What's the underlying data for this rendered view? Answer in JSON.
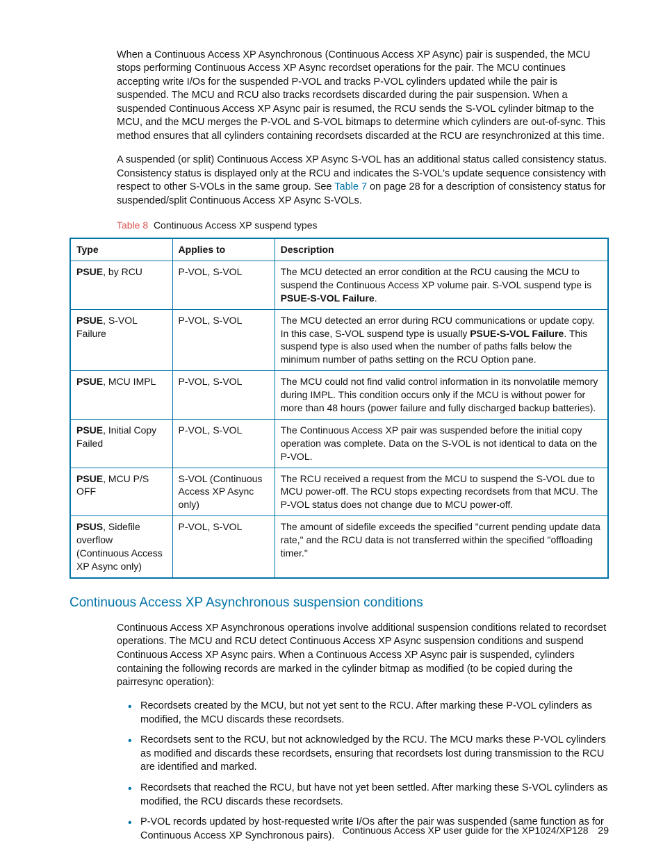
{
  "paragraphs": {
    "p1": "When a Continuous Access XP Asynchronous (Continuous Access XP Async) pair is suspended, the MCU stops performing Continuous Access XP Async recordset operations for the pair. The MCU continues accepting write I/Os for the suspended P-VOL and tracks P-VOL cylinders updated while the pair is suspended. The MCU and RCU also tracks recordsets discarded during the pair suspension. When a suspended Continuous Access XP Async pair is resumed, the RCU sends the S-VOL cylinder bitmap to the MCU, and the MCU merges the P-VOL and S-VOL bitmaps to determine which cylinders are out-of-sync. This method ensures that all cylinders containing recordsets discarded at the RCU are resynchronized at this time.",
    "p2_pre": "A suspended (or split) Continuous Access XP Async S-VOL has an additional status called consistency status. Consistency status is displayed only at the RCU and indicates the S-VOL's update sequence consistency with respect to other S-VOLs in the same group. See ",
    "p2_link": "Table 7",
    "p2_post": " on page 28 for a description of consistency status for suspended/split Continuous Access XP Async S-VOLs.",
    "p3": "Continuous Access XP Asynchronous operations involve additional suspension conditions related to recordset operations. The MCU and RCU detect Continuous Access XP Async suspension conditions and suspend Continuous Access XP Async pairs. When a Continuous Access XP Async pair is suspended, cylinders containing the following records are marked in the cylinder bitmap as modified (to be copied during the pairresync operation):"
  },
  "table_caption": {
    "label": "Table 8",
    "text": "Continuous Access XP suspend types"
  },
  "table": {
    "headers": {
      "c1": "Type",
      "c2": "Applies to",
      "c3": "Description"
    },
    "rows": [
      {
        "type_bold": "PSUE",
        "type_rest": ", by RCU",
        "applies": "P-VOL, S-VOL",
        "desc_pre": "The MCU detected an error condition at the RCU causing the MCU to suspend the Continuous Access XP volume pair. S-VOL suspend type is ",
        "desc_bold": "PSUE-S-VOL Failure",
        "desc_post": "."
      },
      {
        "type_bold": "PSUE",
        "type_rest": ", S-VOL Failure",
        "applies": "P-VOL, S-VOL",
        "desc_pre": "The MCU detected an error during RCU communications or update copy. In this case, S-VOL suspend type is usually ",
        "desc_bold": "PSUE-S-VOL Failure",
        "desc_post": ". This suspend type is also used when the number of paths falls below the minimum number of paths setting on the RCU Option pane."
      },
      {
        "type_bold": "PSUE",
        "type_rest": ", MCU IMPL",
        "applies": "P-VOL, S-VOL",
        "desc_pre": "The MCU could not find valid control information in its nonvolatile memory during IMPL. This condition occurs only if the MCU is without power for more than 48 hours (power failure and fully discharged backup batteries).",
        "desc_bold": "",
        "desc_post": ""
      },
      {
        "type_bold": "PSUE",
        "type_rest": ", Initial Copy Failed",
        "applies": "P-VOL, S-VOL",
        "desc_pre": "The Continuous Access XP pair was suspended before the initial copy operation was complete. Data on the S-VOL is not identical to data on the P-VOL.",
        "desc_bold": "",
        "desc_post": ""
      },
      {
        "type_bold": "PSUE",
        "type_rest": ", MCU P/S OFF",
        "applies": "S-VOL (Continuous Access XP Async only)",
        "desc_pre": "The RCU received a request from the MCU to suspend the S-VOL due to MCU power-off. The RCU stops expecting recordsets from that MCU. The P-VOL status does not change due to MCU power-off.",
        "desc_bold": "",
        "desc_post": ""
      },
      {
        "type_bold": "PSUS",
        "type_rest": ", Sidefile overflow (Continuous Access XP Async only)",
        "applies": "P-VOL, S-VOL",
        "desc_pre": "The amount of sidefile exceeds the specified \"current pending update data rate,\" and the RCU data is not transferred within the specified \"offloading timer.\"",
        "desc_bold": "",
        "desc_post": ""
      }
    ]
  },
  "section_heading": "Continuous Access XP Asynchronous suspension conditions",
  "bullets": [
    "Recordsets created by the MCU, but not yet sent to the RCU. After marking these P-VOL cylinders as modified, the MCU discards these recordsets.",
    "Recordsets sent to the RCU, but not acknowledged by the RCU. The MCU marks these P-VOL cylinders as modified and discards these recordsets, ensuring that recordsets lost during transmission to the RCU are identified and marked.",
    "Recordsets that reached the RCU, but have not yet been settled. After marking these S-VOL cylinders as modified, the RCU discards these recordsets.",
    "P-VOL records updated by host-requested write I/Os after the pair was suspended (same function as for Continuous Access XP Synchronous pairs)."
  ],
  "footer": {
    "title": "Continuous Access XP user guide for the XP1024/XP128",
    "page": "29"
  }
}
